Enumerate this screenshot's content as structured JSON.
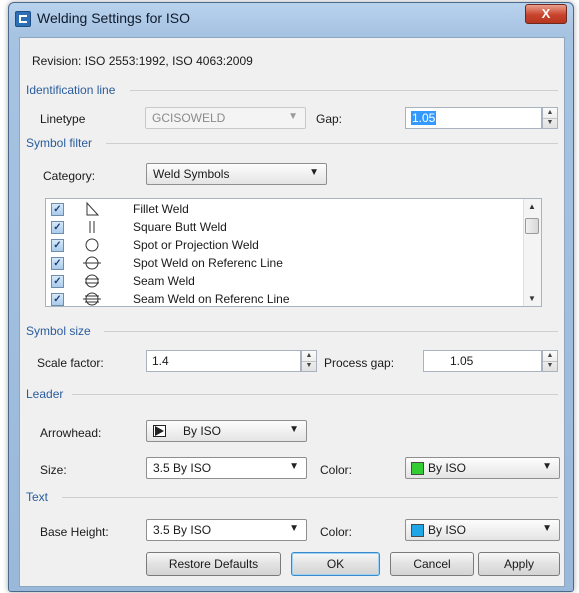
{
  "window": {
    "title": "Welding Settings for ISO",
    "close_glyph": "X"
  },
  "revision": "Revision: ISO 2553:1992, ISO 4063:2009",
  "identification": {
    "section_label": "Identification line",
    "linetype_label": "Linetype",
    "linetype_value": "GCISOWELD",
    "gap_label": "Gap:",
    "gap_value": "1.05"
  },
  "symbol_filter": {
    "section_label": "Symbol filter",
    "category_label": "Category:",
    "category_value": "Weld Symbols",
    "items": [
      {
        "label": "Fillet Weld",
        "checked": true,
        "icon": "fillet-weld-icon"
      },
      {
        "label": "Square Butt Weld",
        "checked": true,
        "icon": "square-butt-weld-icon"
      },
      {
        "label": "Spot or Projection Weld",
        "checked": true,
        "icon": "spot-weld-icon"
      },
      {
        "label": "Spot Weld on Referenc Line",
        "checked": true,
        "icon": "spot-weld-reference-icon"
      },
      {
        "label": "Seam Weld",
        "checked": true,
        "icon": "seam-weld-icon"
      },
      {
        "label": "Seam Weld on Referenc Line",
        "checked": true,
        "icon": "seam-weld-reference-icon"
      }
    ],
    "check_glyph": "✓"
  },
  "symbol_size": {
    "section_label": "Symbol size",
    "scale_label": "Scale factor:",
    "scale_value": "1.4",
    "process_gap_label": "Process gap:",
    "process_gap_value": "1.05"
  },
  "leader": {
    "section_label": "Leader",
    "arrowhead_label": "Arrowhead:",
    "arrowhead_value": "By ISO",
    "size_label": "Size:",
    "size_value": "3.5 By ISO",
    "color_label": "Color:",
    "color_value": "By ISO",
    "color_swatch": "#33cc33"
  },
  "text": {
    "section_label": "Text",
    "base_height_label": "Base Height:",
    "base_height_value": "3.5 By ISO",
    "color_label": "Color:",
    "color_value": "By ISO",
    "color_swatch": "#1ea6e6"
  },
  "buttons": {
    "restore": "Restore Defaults",
    "ok": "OK",
    "cancel": "Cancel",
    "apply": "Apply"
  },
  "glyphs": {
    "dropdown": "▼",
    "spin_up": "▲",
    "spin_down": "▼"
  }
}
